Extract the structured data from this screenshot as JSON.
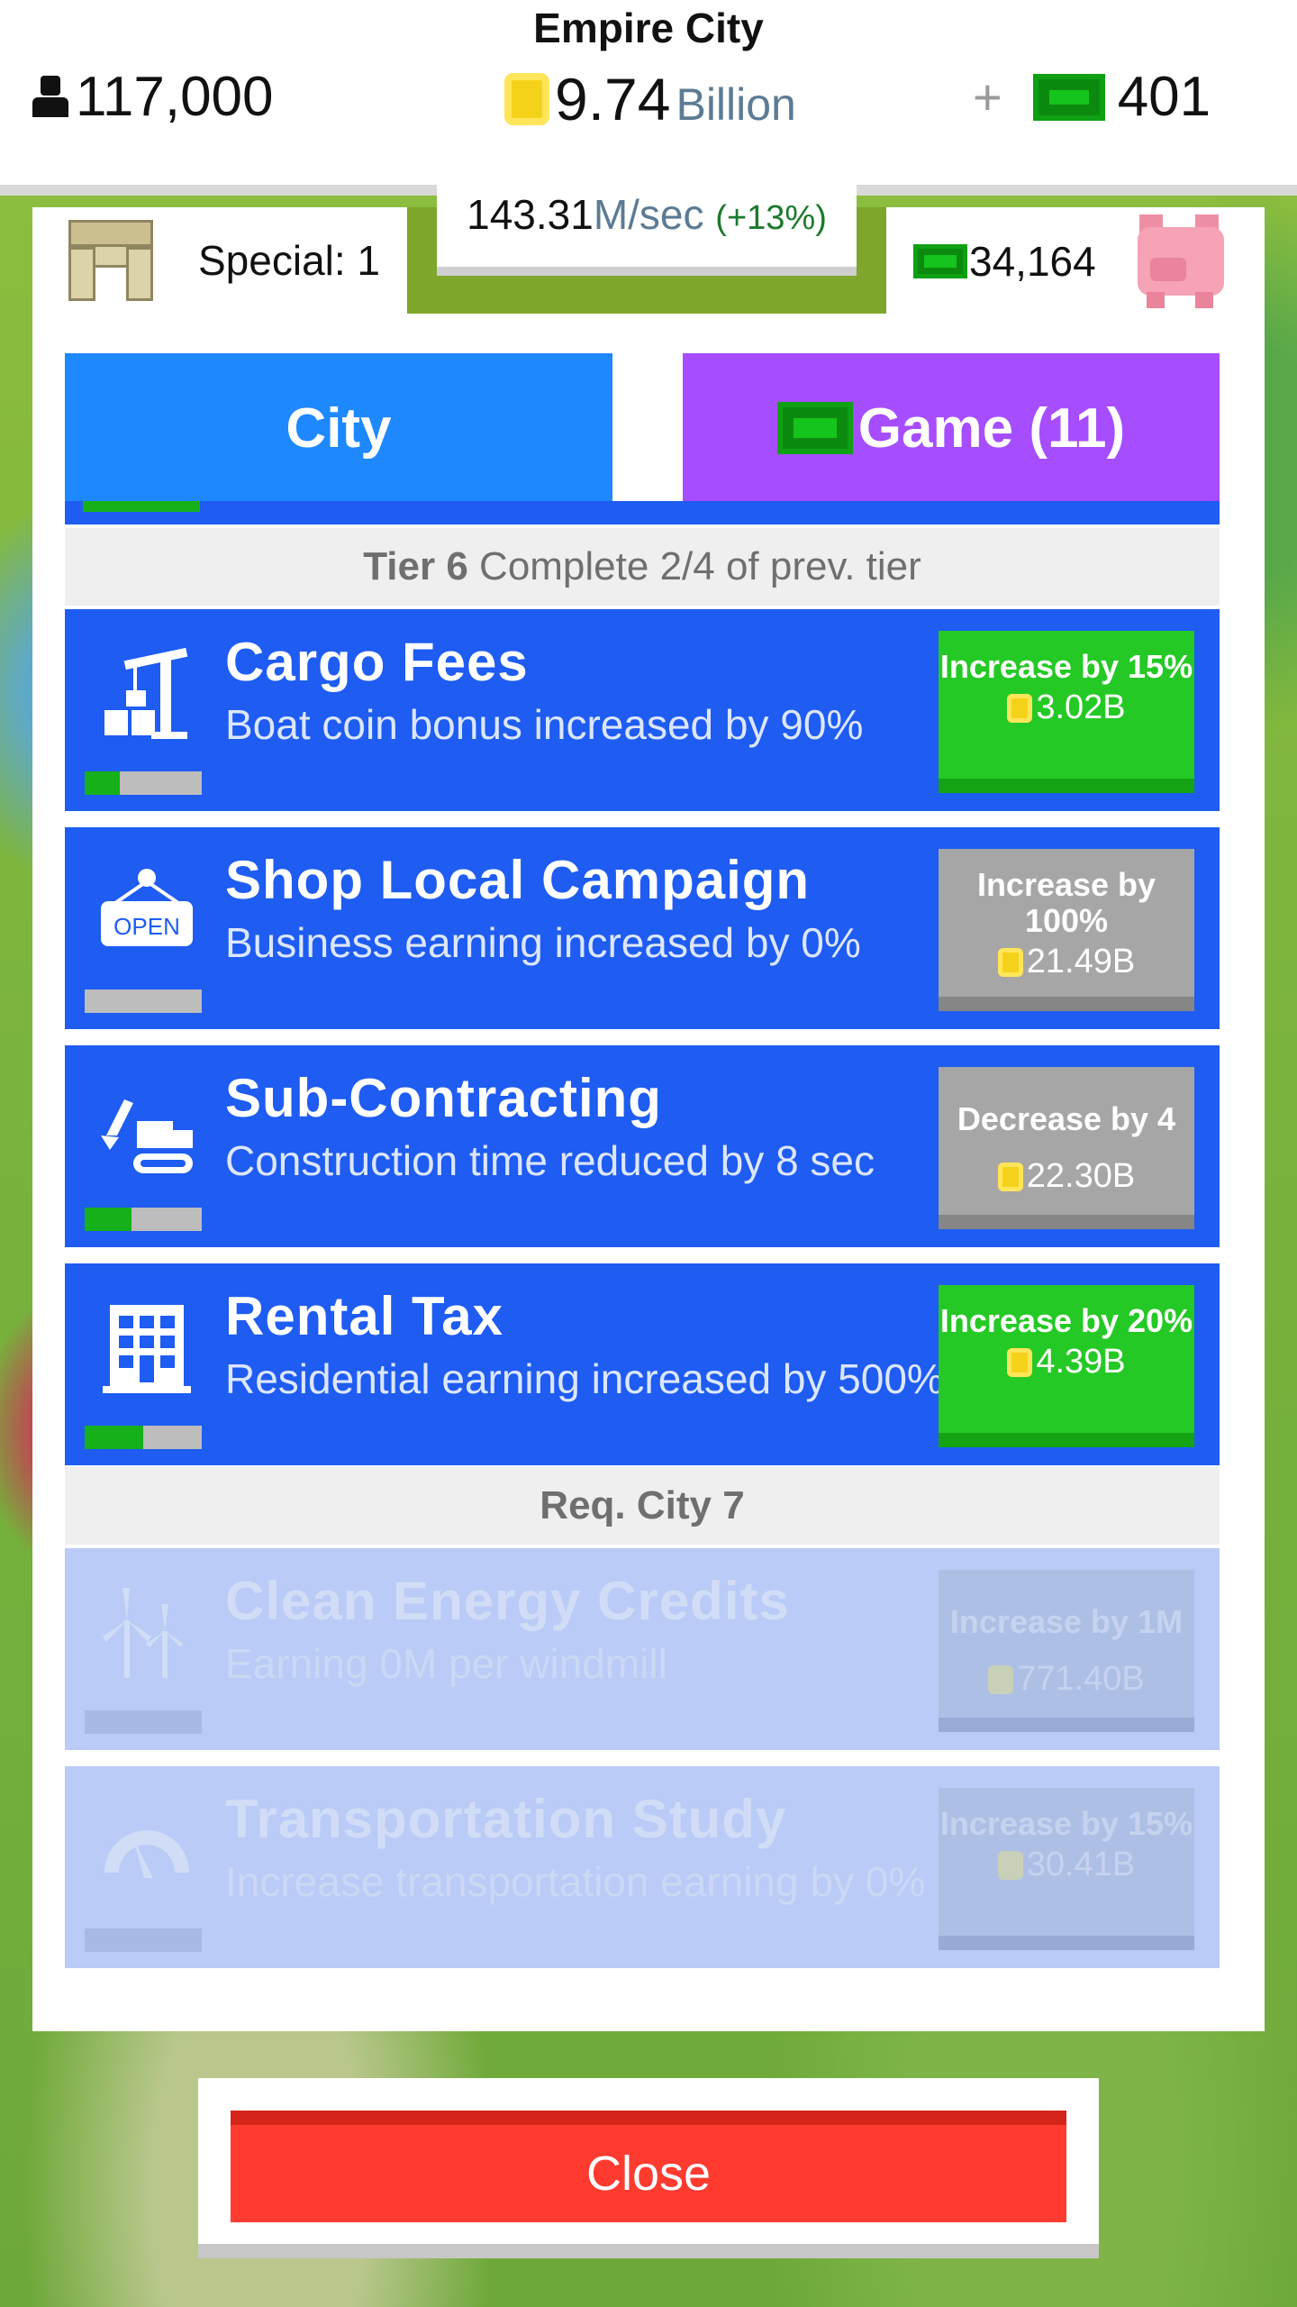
{
  "header": {
    "city_name": "Empire City",
    "population": "117,000",
    "coins_value": "9.74",
    "coins_unit": "Billion",
    "plus_label": "+",
    "cash": "401"
  },
  "rate": {
    "value": "143.31",
    "unit": "M/sec",
    "percent": "(+13%)"
  },
  "special": {
    "label": "Special: 1"
  },
  "bank": {
    "value": "34,164"
  },
  "tabs": [
    {
      "label": "City",
      "active": true
    },
    {
      "label": "Game (11)",
      "active": false
    }
  ],
  "tier": {
    "bold": "Tier 6",
    "text": " Complete 2/4 of prev. tier"
  },
  "upgrades": [
    {
      "title": "Cargo Fees",
      "desc": "Boat coin bonus increased by 90%",
      "button": "Increase by 15%",
      "cost": "3.02B",
      "progress": 0.3,
      "affordable": true,
      "icon": "crane-icon"
    },
    {
      "title": "Shop Local Campaign",
      "desc": "Business earning increased by 0%",
      "button": "Increase by 100%",
      "cost": "21.49B",
      "progress": 0,
      "affordable": false,
      "icon": "open-sign-icon"
    },
    {
      "title": "Sub-Contracting",
      "desc": "Construction time reduced by 8 sec",
      "button": "Decrease by 4",
      "cost": "22.30B",
      "progress": 0.4,
      "affordable": false,
      "icon": "excavator-icon"
    },
    {
      "title": "Rental Tax",
      "desc": "Residential earning increased by 500%",
      "button": "Increase by 20%",
      "cost": "4.39B",
      "progress": 0.5,
      "affordable": true,
      "icon": "building-icon"
    }
  ],
  "requirement": {
    "label": "Req. City 7"
  },
  "locked_upgrades": [
    {
      "title": "Clean Energy Credits",
      "desc": "Earning 0M per windmill",
      "button": "Increase by 1M",
      "cost": "771.40B",
      "icon": "windmill-icon"
    },
    {
      "title": "Transportation Study",
      "desc": "Increase transportation earning by 0%",
      "button": "Increase by 15%",
      "cost": "30.41B",
      "icon": "speedometer-icon"
    }
  ],
  "close": {
    "label": "Close"
  }
}
